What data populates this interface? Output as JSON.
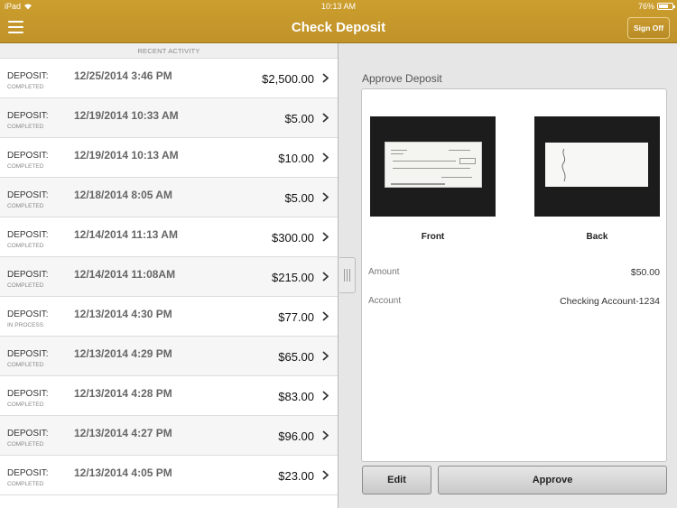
{
  "status_bar": {
    "carrier": "iPad",
    "time": "10:13 AM",
    "battery": "76%"
  },
  "nav": {
    "title": "Check Deposit",
    "sign_off": "Sign Off",
    "menu_icon": "hamburger-menu-icon"
  },
  "recent": {
    "section_title": "RECENT ACTIVITY",
    "items": [
      {
        "type": "DEPOSIT:",
        "status": "COMPLETED",
        "date": "12/25/2014 3:46 PM",
        "amount": "$2,500.00"
      },
      {
        "type": "DEPOSIT:",
        "status": "COMPLETED",
        "date": "12/19/2014 10:33 AM",
        "amount": "$5.00"
      },
      {
        "type": "DEPOSIT:",
        "status": "COMPLETED",
        "date": "12/19/2014 10:13 AM",
        "amount": "$10.00"
      },
      {
        "type": "DEPOSIT:",
        "status": "COMPLETED",
        "date": "12/18/2014 8:05 AM",
        "amount": "$5.00"
      },
      {
        "type": "DEPOSIT:",
        "status": "COMPLETED",
        "date": "12/14/2014 11:13 AM",
        "amount": "$300.00"
      },
      {
        "type": "DEPOSIT:",
        "status": "COMPLETED",
        "date": "12/14/2014 11:08AM",
        "amount": "$215.00"
      },
      {
        "type": "DEPOSIT:",
        "status": "IN PROCESS",
        "date": "12/13/2014 4:30 PM",
        "amount": "$77.00"
      },
      {
        "type": "DEPOSIT:",
        "status": "COMPLETED",
        "date": "12/13/2014 4:29 PM",
        "amount": "$65.00"
      },
      {
        "type": "DEPOSIT:",
        "status": "COMPLETED",
        "date": "12/13/2014 4:28 PM",
        "amount": "$83.00"
      },
      {
        "type": "DEPOSIT:",
        "status": "COMPLETED",
        "date": "12/13/2014 4:27 PM",
        "amount": "$96.00"
      },
      {
        "type": "DEPOSIT:",
        "status": "COMPLETED",
        "date": "12/13/2014 4:05 PM",
        "amount": "$23.00"
      }
    ]
  },
  "approve": {
    "title": "Approve Deposit",
    "front_label": "Front",
    "back_label": "Back",
    "amount_label": "Amount",
    "amount_value": "$50.00",
    "account_label": "Account",
    "account_value": "Checking Account-1234",
    "edit_button": "Edit",
    "approve_button": "Approve"
  },
  "colors": {
    "brand": "#c79a2d",
    "background": "#e6e6e6"
  }
}
